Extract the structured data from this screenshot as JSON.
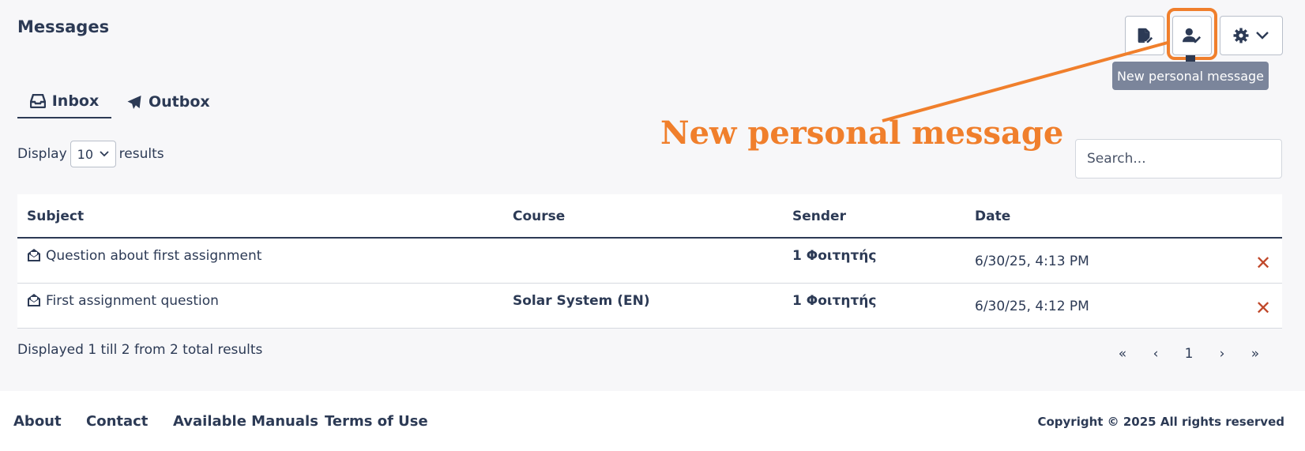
{
  "page": {
    "title": "Messages"
  },
  "toolbar": {
    "tooltip": "New personal message"
  },
  "annotation": {
    "text": "New personal message",
    "color": "#f07f2c"
  },
  "tabs": [
    {
      "label": "Inbox",
      "icon": "inbox-icon",
      "active": true
    },
    {
      "label": "Outbox",
      "icon": "paper-plane-icon",
      "active": false
    }
  ],
  "display": {
    "prefix": "Display",
    "value": "10",
    "suffix": "results"
  },
  "search": {
    "placeholder": "Search..."
  },
  "table": {
    "headers": {
      "subject": "Subject",
      "course": "Course",
      "sender": "Sender",
      "date": "Date"
    },
    "rows": [
      {
        "subject": "Question about first assignment",
        "course": "",
        "sender": "1 Φοιτητής",
        "date": "6/30/25, 4:13 PM",
        "delete": "✕"
      },
      {
        "subject": "First assignment question",
        "course": "Solar System (EN)",
        "sender": "1 Φοιτητής",
        "date": "6/30/25, 4:12 PM",
        "delete": "✕"
      }
    ]
  },
  "summary": "Displayed 1 till 2 from 2 total results",
  "pagination": {
    "first": "«",
    "prev": "‹",
    "current": "1",
    "next": "›",
    "last": "»"
  },
  "footer": {
    "links": [
      "About",
      "Contact",
      "Available Manuals",
      "Terms of Use"
    ],
    "copyright": "Copyright © 2025 All rights reserved"
  },
  "colors": {
    "accent": "#f07f2c",
    "text": "#2c3a55",
    "danger": "#c0482a",
    "tooltip_bg": "#7b859b"
  }
}
